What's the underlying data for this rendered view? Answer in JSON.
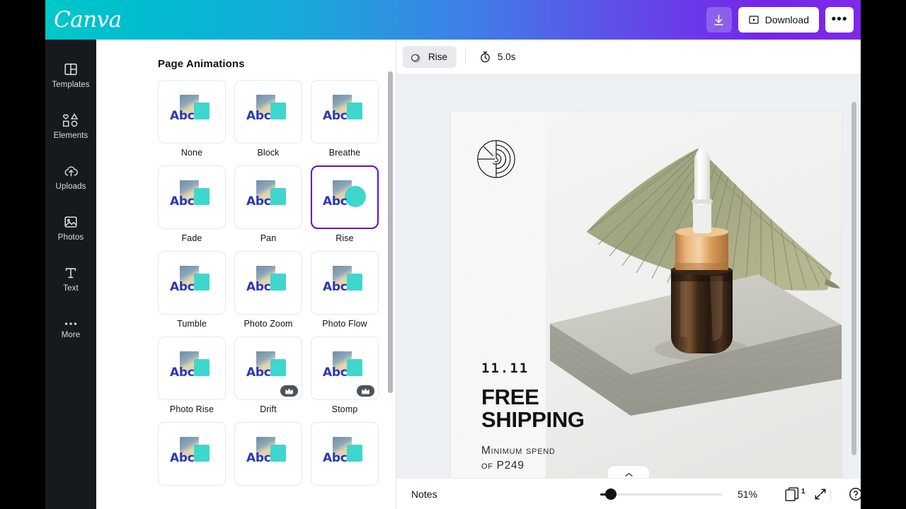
{
  "app": {
    "brand": "Canva",
    "brand_logo_icon": "canva-wordmark"
  },
  "header": {
    "download_icon": "download-arrow-icon",
    "download_label": "Download",
    "download_play_icon": "play-square-icon",
    "more_label": "•••",
    "more_icon": "ellipsis-icon",
    "gradient_from": "#00c8c8",
    "gradient_to": "#7d2ae8"
  },
  "sidebar": {
    "items": [
      {
        "label": "Templates",
        "icon": "templates-grid-icon"
      },
      {
        "label": "Elements",
        "icon": "shapes-icon"
      },
      {
        "label": "Uploads",
        "icon": "cloud-upload-icon"
      },
      {
        "label": "Photos",
        "icon": "image-icon"
      },
      {
        "label": "Text",
        "icon": "text-t-icon"
      },
      {
        "label": "More",
        "icon": "ellipsis-icon"
      }
    ]
  },
  "panel": {
    "title": "Page Animations",
    "animations": [
      {
        "label": "None",
        "style": "square",
        "pro": false,
        "selected": false
      },
      {
        "label": "Block",
        "style": "square",
        "pro": false,
        "selected": false
      },
      {
        "label": "Breathe",
        "style": "square",
        "pro": false,
        "selected": false
      },
      {
        "label": "Fade",
        "style": "square",
        "pro": false,
        "selected": false
      },
      {
        "label": "Pan",
        "style": "square",
        "pro": false,
        "selected": false
      },
      {
        "label": "Rise",
        "style": "circle",
        "pro": false,
        "selected": true
      },
      {
        "label": "Tumble",
        "style": "square",
        "pro": false,
        "selected": false
      },
      {
        "label": "Photo Zoom",
        "style": "square",
        "pro": false,
        "selected": false
      },
      {
        "label": "Photo Flow",
        "style": "square",
        "pro": false,
        "selected": false
      },
      {
        "label": "Photo Rise",
        "style": "square",
        "pro": false,
        "selected": false
      },
      {
        "label": "Drift",
        "style": "square",
        "pro": true,
        "selected": false
      },
      {
        "label": "Stomp",
        "style": "square",
        "pro": true,
        "selected": false
      },
      {
        "label": "",
        "style": "square",
        "pro": false,
        "selected": false
      },
      {
        "label": "",
        "style": "square",
        "pro": false,
        "selected": false
      },
      {
        "label": "",
        "style": "square",
        "pro": false,
        "selected": false
      }
    ],
    "thumb_text": "Abc",
    "crown_icon": "crown-icon",
    "accent_selected": "#6c0ab7",
    "thumb_shape_color": "#3fd6cd",
    "thumb_text_color": "#2b37b5"
  },
  "toolbar": {
    "animation_chip_label": "Rise",
    "animation_chip_icon": "animation-stack-icon",
    "duration_label": "5.0s",
    "duration_icon": "stopwatch-icon"
  },
  "design": {
    "logo_icon": "spiral-nautilus-logo",
    "date": "11.11",
    "headline": "FREE\nSHIPPING",
    "subtext": "Minimum spend\nof P249",
    "photo_alt": "serum-dropper-bottle-with-dried-palm-leaf-on-concrete-slab"
  },
  "bottom": {
    "notes_label": "Notes",
    "zoom_percent": "51%",
    "zoom_value": 51,
    "page_number": "1",
    "page_icon": "pages-stack-icon",
    "fullscreen_icon": "expand-arrows-icon",
    "help_icon": "question-circle-icon",
    "checklist_icon": "notes-checklist-icon",
    "collapse_icon": "chevron-up-icon"
  }
}
